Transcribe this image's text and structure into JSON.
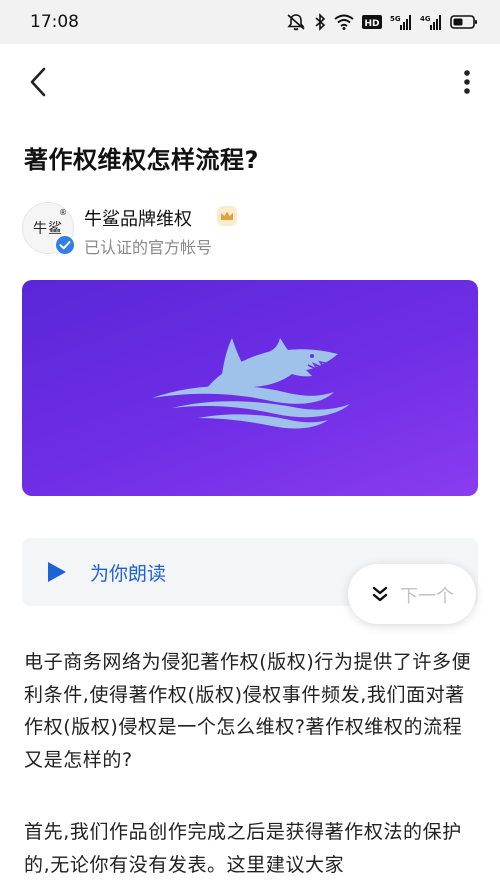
{
  "status_bar": {
    "time": "17:08",
    "icons": [
      "mute-bell-icon",
      "bluetooth-icon",
      "wifi-icon",
      "hd-icon",
      "signal-5g-icon",
      "signal-4g-icon",
      "battery-icon"
    ],
    "hd_label": "HD",
    "net1": "5G",
    "net2": "4G"
  },
  "article": {
    "title": "著作权维权怎样流程?",
    "author_name": "牛鲨品牌维权",
    "author_subtitle": "已认证的官方帐号",
    "avatar_text": "牛鲨",
    "avatar_reg": "®"
  },
  "reader": {
    "label": "为你朗读",
    "right_text": "…"
  },
  "next_button": {
    "label": "下一个"
  },
  "body": {
    "paragraph_1": "电子商务网络为侵犯著作权(版权)行为提供了许多便利条件,使得著作权(版权)侵权事件频发,我们面对著作权(版权)侵权是一个怎么维权?著作权维权的流程又是怎样的?",
    "paragraph_2": "首先,我们作品创作完成之后是获得著作权法的保护的,无论你有没有发表。这里建议大家"
  },
  "colors": {
    "accent_blue": "#1e62d8",
    "banner_start": "#5a26d8",
    "banner_end": "#8a3cf0",
    "shark": "#9fc2ea",
    "crown": "#e0a23a"
  }
}
